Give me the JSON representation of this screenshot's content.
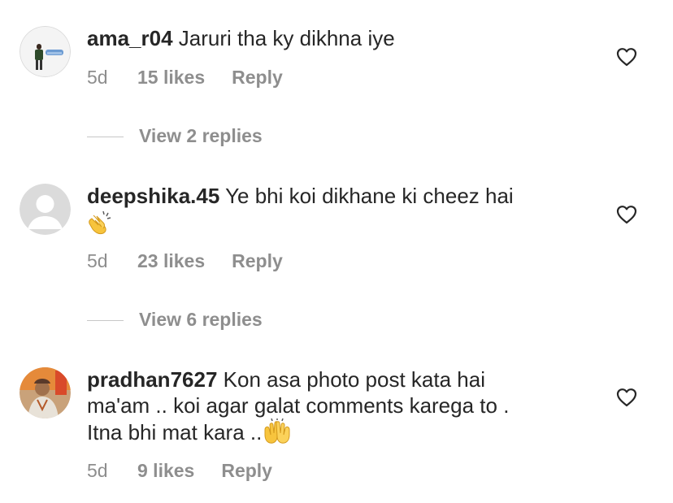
{
  "comments": [
    {
      "username": "ama_r04",
      "text": "Jaruri tha ky dikhna iye",
      "age": "5d",
      "likes": "15 likes",
      "reply": "Reply",
      "view_replies": "View 2 replies",
      "avatar": "photo-avatar"
    },
    {
      "username": "deepshika.45",
      "text": "Ye bhi koi dikhane ki cheez hai",
      "emoji": "clapping-hands-emoji",
      "age": "5d",
      "likes": "23 likes",
      "reply": "Reply",
      "view_replies": "View 6 replies",
      "avatar": "default-avatar"
    },
    {
      "username": "pradhan7627",
      "text_line1": "Kon asa photo post kata hai",
      "text_line2": "ma'am .. koi agar galat comments karega to .",
      "text_line3": "Itna bhi mat kara ..",
      "emoji": "raising-hands-emoji",
      "age": "5d",
      "likes": "9 likes",
      "reply": "Reply",
      "avatar": "photo-avatar"
    }
  ],
  "colors": {
    "text": "#262626",
    "secondary": "#8e8e8e",
    "divider": "#c7c7c7",
    "emoji": "#f7c43d"
  },
  "icons": [
    "heart-icon",
    "clapping-hands-emoji",
    "raising-hands-emoji"
  ]
}
